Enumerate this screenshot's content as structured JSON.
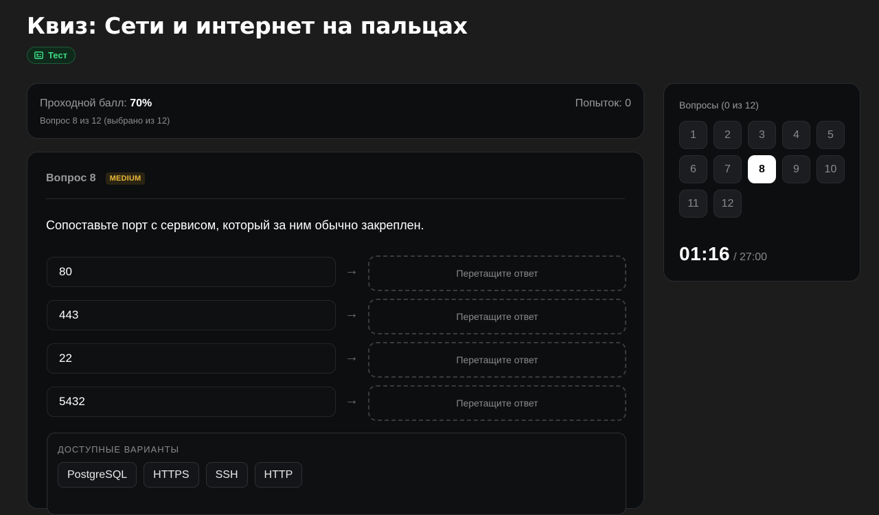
{
  "page": {
    "title": "Квиз: Сети и интернет на пальцах",
    "badge_label": "Тест",
    "badge_icon": "quiz-card-icon"
  },
  "score": {
    "passing_label": "Проходной балл:",
    "passing_value": "70%",
    "progress_text": "Вопрос 8 из 12 (выбрано из 12)",
    "attempts_text": "Попыток: 0"
  },
  "question": {
    "number_label": "Вопрос 8",
    "difficulty": "MEDIUM",
    "text": "Сопоставьте порт с сервисом, который за ним обычно закреплен.",
    "arrow_glyph": "→",
    "pairs": [
      {
        "left": "80",
        "placeholder": "Перетащите ответ"
      },
      {
        "left": "443",
        "placeholder": "Перетащите ответ"
      },
      {
        "left": "22",
        "placeholder": "Перетащите ответ"
      },
      {
        "left": "5432",
        "placeholder": "Перетащите ответ"
      }
    ],
    "options_title": "ДОСТУПНЫЕ ВАРИАНТЫ",
    "options": [
      "PostgreSQL",
      "HTTPS",
      "SSH",
      "HTTP"
    ]
  },
  "navigator": {
    "title": "Вопросы (0 из 12)",
    "questions": [
      "1",
      "2",
      "3",
      "4",
      "5",
      "6",
      "7",
      "8",
      "9",
      "10",
      "11",
      "12"
    ],
    "current": "8",
    "timer_elapsed": "01:16",
    "timer_total": "/ 27:00"
  },
  "colors": {
    "background": "#1c1c1c",
    "card": "#0d0e10",
    "accent_green": "#3ddc84",
    "difficulty_yellow": "#e8b83a"
  }
}
